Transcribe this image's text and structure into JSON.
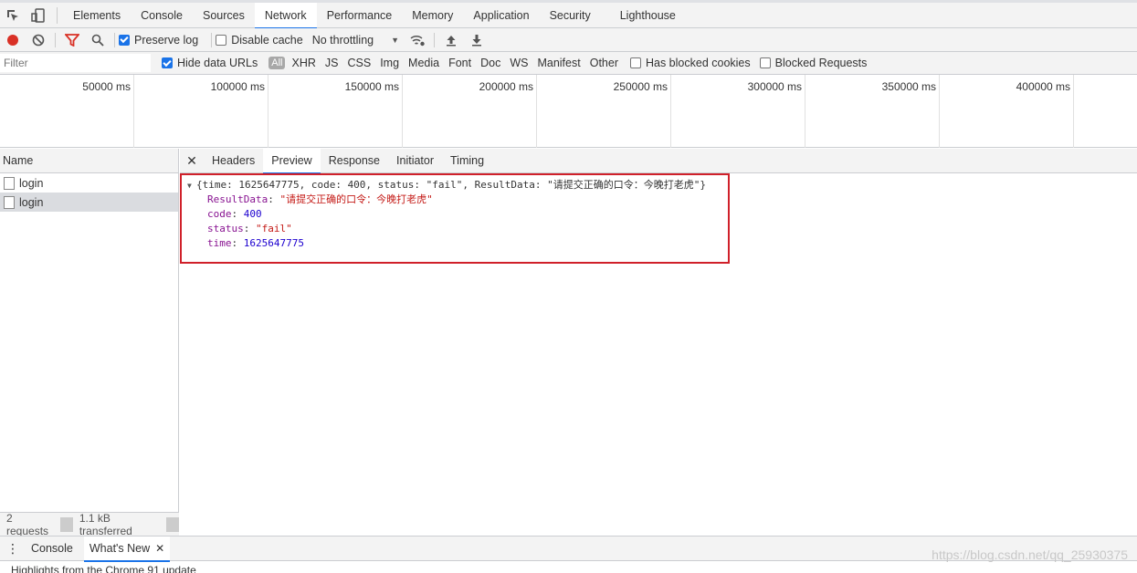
{
  "main_tabs": [
    "Elements",
    "Console",
    "Sources",
    "Network",
    "Performance",
    "Memory",
    "Application",
    "Security",
    "Lighthouse"
  ],
  "active_main_tab": "Network",
  "toolbar": {
    "preserve_log": "Preserve log",
    "disable_cache": "Disable cache",
    "throttling": "No throttling",
    "preserve_log_checked": true,
    "disable_cache_checked": false
  },
  "filter": {
    "placeholder": "Filter",
    "hide_data_urls": "Hide data URLs",
    "types": [
      "All",
      "XHR",
      "JS",
      "CSS",
      "Img",
      "Media",
      "Font",
      "Doc",
      "WS",
      "Manifest",
      "Other"
    ],
    "has_blocked_cookies": "Has blocked cookies",
    "blocked_requests": "Blocked Requests"
  },
  "timeline": {
    "ticks": [
      "50000 ms",
      "100000 ms",
      "150000 ms",
      "200000 ms",
      "250000 ms",
      "300000 ms",
      "350000 ms",
      "400000 ms"
    ]
  },
  "requests": {
    "header": "Name",
    "items": [
      "login",
      "login"
    ],
    "selected_index": 1,
    "summary": {
      "count": "2 requests",
      "transferred": "1.1 kB transferred"
    }
  },
  "detail": {
    "tabs": [
      "Headers",
      "Preview",
      "Response",
      "Initiator",
      "Timing"
    ],
    "active_tab": "Preview",
    "preview": {
      "summary": "{time: 1625647775, code: 400, status: \"fail\", ResultData: \"请提交正确的口令：今晚打老虎\"}",
      "fields": [
        {
          "key": "ResultData",
          "value": "\"请提交正确的口令：今晚打老虎\"",
          "kind": "string"
        },
        {
          "key": "code",
          "value": "400",
          "kind": "number"
        },
        {
          "key": "status",
          "value": "\"fail\"",
          "kind": "string"
        },
        {
          "key": "time",
          "value": "1625647775",
          "kind": "number"
        }
      ]
    }
  },
  "drawer": {
    "tabs": [
      "Console",
      "What's New"
    ],
    "active_tab": "What's New",
    "content": "Highlights from the Chrome 91 update"
  },
  "watermark": "https://blog.csdn.net/qq_25930375",
  "colors": {
    "accent": "#1a73e8",
    "record": "#d93025",
    "highlight_border": "#d0202a"
  }
}
